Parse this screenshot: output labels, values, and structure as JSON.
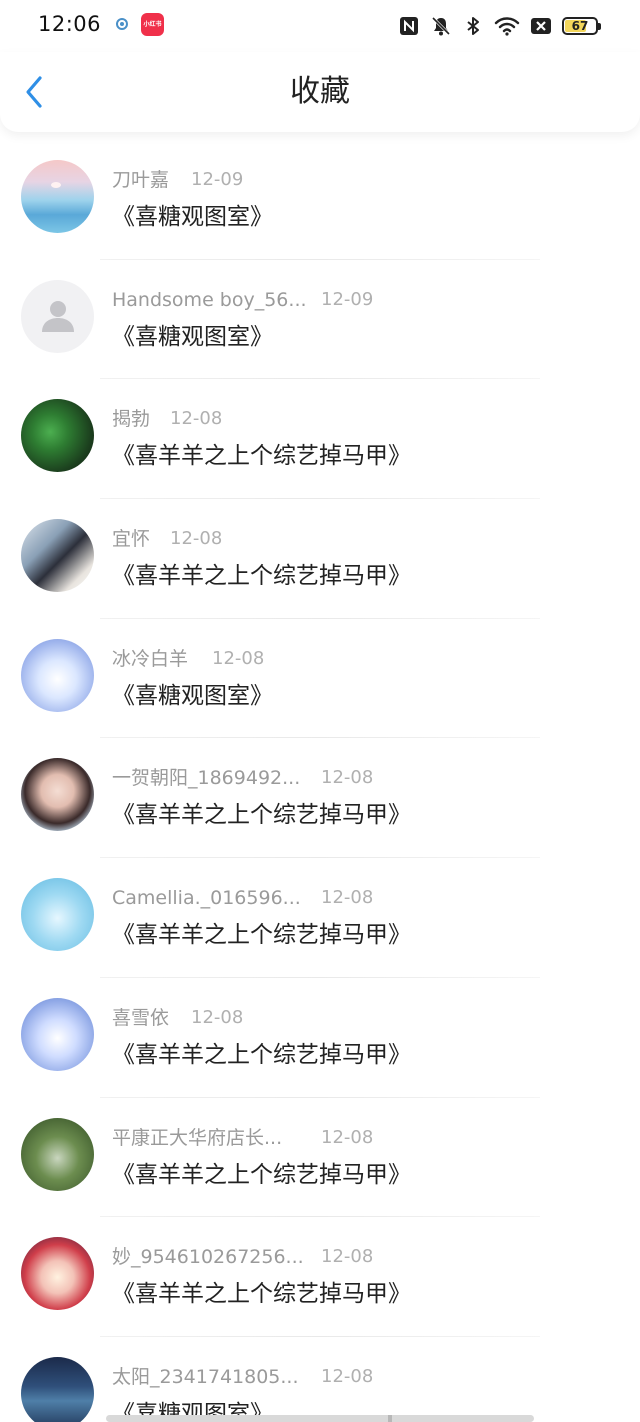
{
  "status_bar": {
    "time": "12:06",
    "app_icon_2_label": "小红书",
    "battery_level": 67,
    "battery_text": "67"
  },
  "header": {
    "title": "收藏"
  },
  "items": [
    {
      "name": "刀叶嘉",
      "date": "12-09",
      "work": "《喜糖观图室》"
    },
    {
      "name": "Handsome boy_56...",
      "date": "12-09",
      "work": "《喜糖观图室》"
    },
    {
      "name": "揭勃",
      "date": "12-08",
      "work": "《喜羊羊之上个综艺掉马甲》"
    },
    {
      "name": "宜怀",
      "date": "12-08",
      "work": "《喜羊羊之上个综艺掉马甲》"
    },
    {
      "name": "冰冷白羊",
      "date": "12-08",
      "work": "《喜糖观图室》"
    },
    {
      "name": "一贺朝阳_1869492...",
      "date": "12-08",
      "work": "《喜羊羊之上个综艺掉马甲》"
    },
    {
      "name": "Camellia._016596...",
      "date": "12-08",
      "work": "《喜羊羊之上个综艺掉马甲》"
    },
    {
      "name": "喜雪依",
      "date": "12-08",
      "work": "《喜羊羊之上个综艺掉马甲》"
    },
    {
      "name": "平康正大华府店长...",
      "date": "12-08",
      "work": "《喜羊羊之上个综艺掉马甲》"
    },
    {
      "name": "妙_954610267256...",
      "date": "12-08",
      "work": "《喜羊羊之上个综艺掉马甲》"
    },
    {
      "name": "太阳_2341741805...",
      "date": "12-08",
      "work": "《喜糖观图室》"
    }
  ],
  "colors": {
    "accent": "#2f8fe6",
    "name_gray": "#9a9a9a",
    "date_gray": "#b0b0b0",
    "text_dark": "#222222"
  }
}
